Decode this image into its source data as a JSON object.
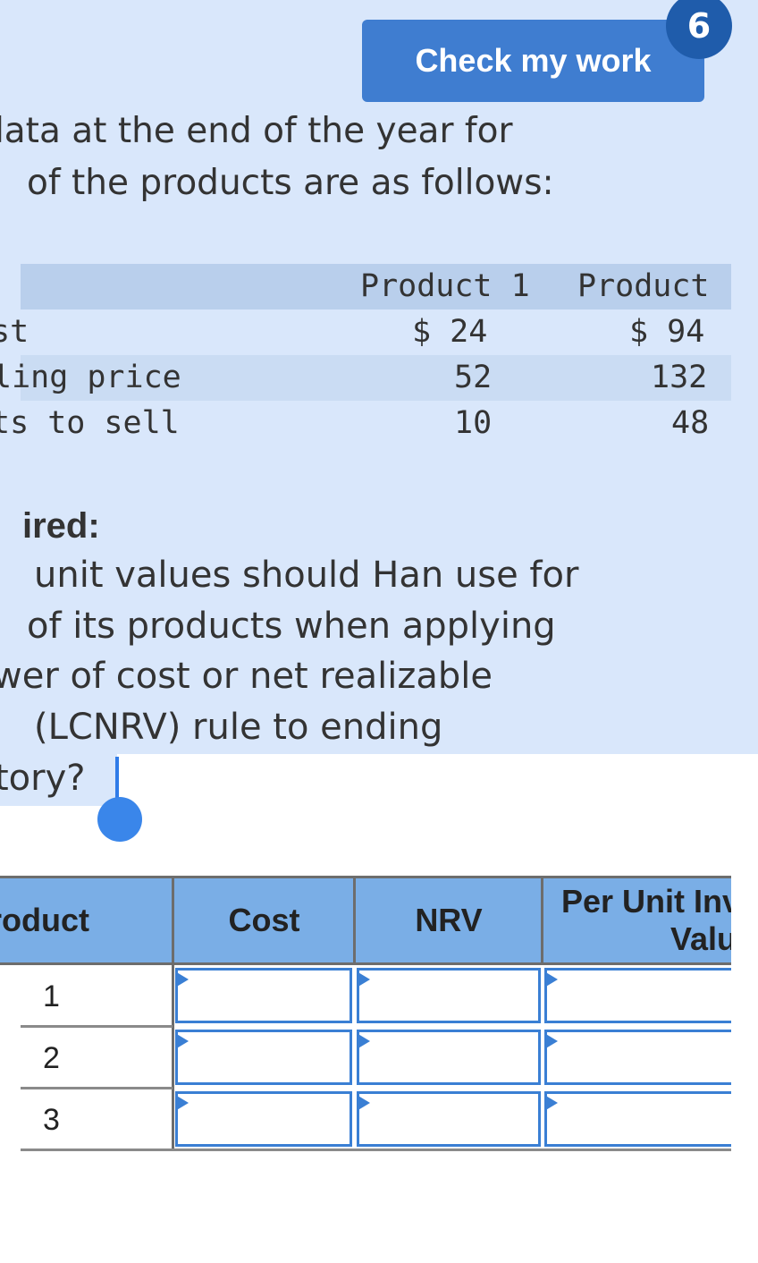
{
  "header": {
    "check_button_label": "Check my work",
    "badge_count": "6"
  },
  "intro": {
    "line1": "data at the end of the year for",
    "line2": "of the products are as follows:"
  },
  "data_table": {
    "columns": [
      "Product 1",
      "Product"
    ],
    "rows": [
      {
        "label": "st",
        "values": [
          "$ 24",
          "$ 94"
        ]
      },
      {
        "label": "ling price",
        "values": [
          "52",
          "132"
        ]
      },
      {
        "label": "ts to sell",
        "values": [
          "10",
          "48"
        ]
      }
    ]
  },
  "question": {
    "heading": "ired:",
    "lines": [
      "unit values should Han use for",
      "of its products when applying",
      "wer of cost or net realizable",
      "(LCNRV) rule to ending",
      "tory?"
    ]
  },
  "answer_table": {
    "headers": [
      "roduct",
      "Cost",
      "NRV",
      "Per Unit Inv",
      "Valu"
    ],
    "rows": [
      "1",
      "2",
      "3"
    ]
  },
  "colors": {
    "button": "#3f7dd0",
    "badge": "#1f5cab",
    "selection": "#d9e7fb",
    "table_header": "#7aaee6",
    "input_border": "#3a7fd4"
  }
}
